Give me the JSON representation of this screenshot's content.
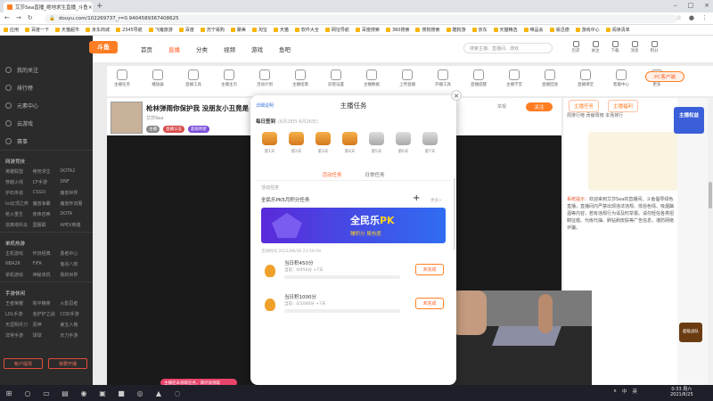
{
  "browser": {
    "tab_title": "艾莎Sea直播_绝地求生直播_斗鱼",
    "url": "douyu.com/102269737_r=0.9404589367408625",
    "bookmarks": [
      "应用",
      "百度一下",
      "天猫超市",
      "京东商城",
      "2345导航",
      "飞猪旅游",
      "百度",
      "苏宁易购",
      "聚美",
      "淘宝",
      "天猫",
      "软件大全",
      "网址导航",
      "百度搜索",
      "360搜索",
      "搜狗搜索",
      "酷狗游",
      "京东",
      "天猫精选",
      "唯品会",
      "易迅德",
      "游戏中心",
      "阅读清单"
    ]
  },
  "sidebar": {
    "nav": [
      "我的关注",
      "排行榜",
      "元素中心",
      "云游戏",
      "赛事"
    ],
    "sections": [
      {
        "title": "网游竞技",
        "items": [
          "英雄联盟",
          "绝地求生",
          "DOTA2",
          "穿越火线",
          "CF手游",
          "DNF",
          "炉石传说",
          "CSGO",
          "魔兽世界",
          "lol云顶之弈",
          "魔兽争霸",
          "魔兽怀旧服",
          "枪火重生",
          "使命召唤",
          "DOTA",
          "逃离塔科夫",
          "国服联",
          "APEX英雄"
        ]
      },
      {
        "title": "单机热游",
        "items": [
          "主机游戏",
          "怀旧经典",
          "勇者中心",
          "NBA2K",
          "FIFA",
          "鬼谷八荒",
          "单机游戏",
          "神秘单机",
          "我的世界"
        ]
      },
      {
        "title": "手游休闲",
        "items": [
          "王者荣耀",
          "和平精英",
          "火影忍者",
          "LOL手游",
          "金铲铲之战",
          "COD手游",
          "天涯明月刀",
          "原神",
          "第五人格",
          "非常手游",
          "球球",
          "天刀手游"
        ]
      }
    ],
    "buttons": [
      "帐户提现",
      "我要开播"
    ]
  },
  "header": {
    "logo": "斗鱼",
    "nav": [
      "首页",
      "直播",
      "分类",
      "视频",
      "游戏",
      "鱼吧"
    ],
    "search_placeholder": "搜索主播、直播间、游戏",
    "icons": [
      {
        "label": "历史"
      },
      {
        "label": "关注"
      },
      {
        "label": "下载"
      },
      {
        "label": "消息"
      },
      {
        "label": "积分"
      }
    ]
  },
  "toolbar": {
    "items": [
      "主播任务",
      "播放器",
      "直播工具",
      "主播主页",
      "活动计划",
      "主播指南",
      "房管设置",
      "主播数据",
      "上传直播",
      "开播工具",
      "直播提醒",
      "主播学堂",
      "直播回放",
      "直播课堂",
      "客服中心",
      "更多"
    ],
    "pc_button": "PC客户端"
  },
  "room": {
    "title": "枪林弹雨你保护我 没朋友小丑竟是",
    "meta": "艾莎Sea",
    "badges": [
      "主播",
      "直播认证",
      "超级明星"
    ],
    "report": "举报",
    "follow": "关注"
  },
  "right_panel": {
    "tabs": [
      "主播任务",
      "主播福利"
    ],
    "head": "周排行榜 贡献周榜 本场排行",
    "chat": [
      {
        "sys": "系统提示：",
        "text": "欢迎来到艾莎Sea的直播间，斗鱼倡导绿色直播，直播间内严禁出现违法违规、低俗色情、吸烟酗酒等内容，若有违规行为请及时举报。请勿轻信各类招聘征婚、代练代抽、刷钻刷皮肤等广告信息，谨防网络诈骗。"
      }
    ],
    "promo": "主播权益",
    "promo2": "超级战队"
  },
  "modal": {
    "help": "详细说明",
    "title": "主播任务",
    "checkin_title": "每日签到",
    "checkin_range": "(6月28日-6月26日)",
    "days": [
      {
        "label": "第1天",
        "state": "on"
      },
      {
        "label": "第2天",
        "state": "on"
      },
      {
        "label": "第3天",
        "state": "on"
      },
      {
        "label": "第4天",
        "state": "on"
      },
      {
        "label": "第5天",
        "state": "off"
      },
      {
        "label": "第6天",
        "state": "off"
      },
      {
        "label": "第7天",
        "state": "off"
      }
    ],
    "tabs": [
      "活动任务",
      "日常任务"
    ],
    "sub": "活动任务",
    "event_title": "全民乐PK5月积分任务",
    "more": "更多>",
    "banner_title_a": "全民乐",
    "banner_title_b": "PK",
    "banner_sub": "赚积分 晃热度",
    "period": "活动时间 2021/06/30 23:59:59",
    "tasks": [
      {
        "name": "当日积450分",
        "progress": "当前：0/450分 +7天",
        "button": "未完成"
      },
      {
        "name": "当日积1000分",
        "progress": "当前：0/1000分 +7天",
        "button": "未完成"
      }
    ]
  },
  "toast": "主播还未领取任务，请尽快领取",
  "taskbar": {
    "right": [
      "∧",
      "中",
      "英"
    ],
    "time": "0:33 周六",
    "date": "2021/6/25"
  },
  "colors": {
    "brand": "#ff7d23",
    "sidebar": "#2b2b2b",
    "banner": "#5a2ad9"
  }
}
